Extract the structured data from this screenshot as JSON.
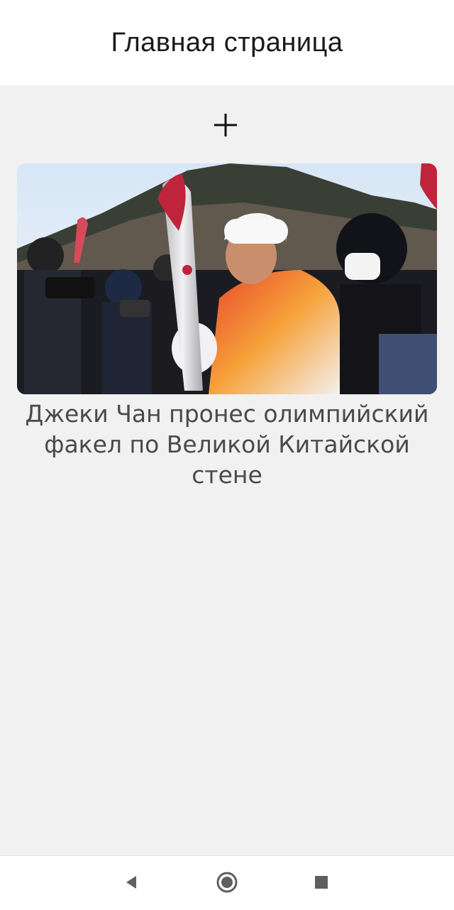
{
  "app_bar": {
    "title": "Главная страница"
  },
  "main": {
    "add_icon": "plus-icon",
    "news": [
      {
        "image_icon": "news-photo",
        "title": "Джеки Чан пронес олимпийский факел по Великой Китайской стене"
      }
    ]
  },
  "navigation_bar": {
    "back_icon": "triangle-back-icon",
    "home_icon": "circle-home-icon",
    "recents_icon": "square-recents-icon"
  },
  "colors": {
    "app_bar_bg": "#ffffff",
    "content_bg": "#f1f1f1",
    "title_text": "#1a1a1a",
    "news_title_text": "#4a4a4a",
    "nav_icon": "#5f5f5f"
  }
}
